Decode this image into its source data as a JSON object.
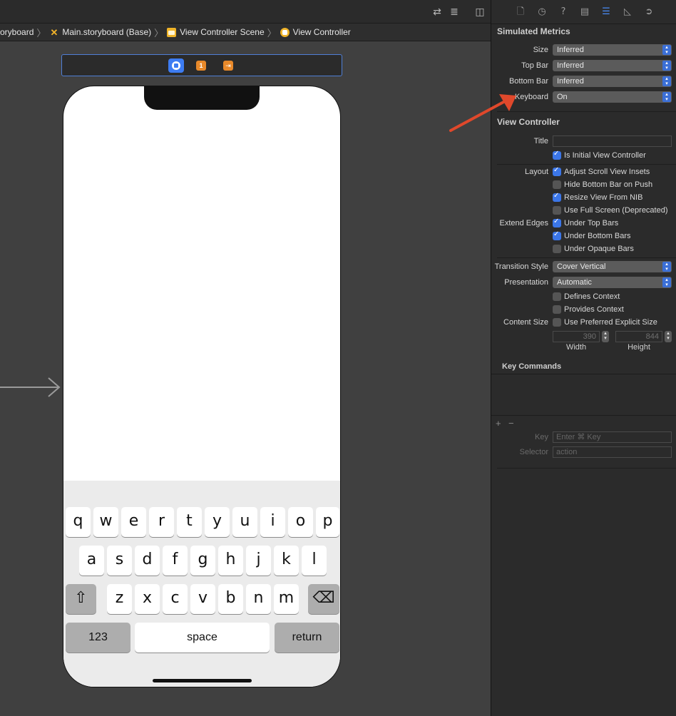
{
  "breadcrumb": [
    {
      "label": "oryboard",
      "icon": "storyboard-file-icon"
    },
    {
      "label": "Main.storyboard (Base)",
      "icon": "storyboard-icon"
    },
    {
      "label": "View Controller Scene",
      "icon": "scene-icon"
    },
    {
      "label": "View Controller",
      "icon": "view-controller-icon"
    }
  ],
  "scene_bar": {
    "badge_first_responder": "1"
  },
  "keyboard": {
    "row1": [
      "q",
      "w",
      "e",
      "r",
      "t",
      "y",
      "u",
      "i",
      "o",
      "p"
    ],
    "row2": [
      "a",
      "s",
      "d",
      "f",
      "g",
      "h",
      "j",
      "k",
      "l"
    ],
    "row3": [
      "z",
      "x",
      "c",
      "v",
      "b",
      "n",
      "m"
    ],
    "shift": "⇧",
    "delete": "⌫",
    "numbers": "123",
    "space": "space",
    "return": "return"
  },
  "inspector": {
    "simulated_metrics": {
      "title": "Simulated Metrics",
      "size_label": "Size",
      "size_value": "Inferred",
      "top_bar_label": "Top Bar",
      "top_bar_value": "Inferred",
      "bottom_bar_label": "Bottom Bar",
      "bottom_bar_value": "Inferred",
      "keyboard_label": "Keyboard",
      "keyboard_value": "On"
    },
    "view_controller": {
      "title": "View Controller",
      "title_label": "Title",
      "title_value": "",
      "is_initial": "Is Initial View Controller",
      "layout_label": "Layout",
      "adjust_scroll": "Adjust Scroll View Insets",
      "hide_bottom_bar": "Hide Bottom Bar on Push",
      "resize_view": "Resize View From NIB",
      "full_screen": "Use Full Screen (Deprecated)",
      "extend_edges_label": "Extend Edges",
      "under_top": "Under Top Bars",
      "under_bottom": "Under Bottom Bars",
      "under_opaque": "Under Opaque Bars",
      "transition_label": "Transition Style",
      "transition_value": "Cover Vertical",
      "presentation_label": "Presentation",
      "presentation_value": "Automatic",
      "defines_context": "Defines Context",
      "provides_context": "Provides Context",
      "content_size_label": "Content Size",
      "preferred_size": "Use Preferred Explicit Size",
      "width_value": "390",
      "height_value": "844",
      "width_label": "Width",
      "height_label": "Height"
    },
    "key_commands": {
      "title": "Key Commands",
      "add": "+",
      "remove": "−",
      "key_label": "Key",
      "key_placeholder": "Enter ⌘ Key",
      "selector_label": "Selector",
      "selector_placeholder": "action"
    }
  }
}
